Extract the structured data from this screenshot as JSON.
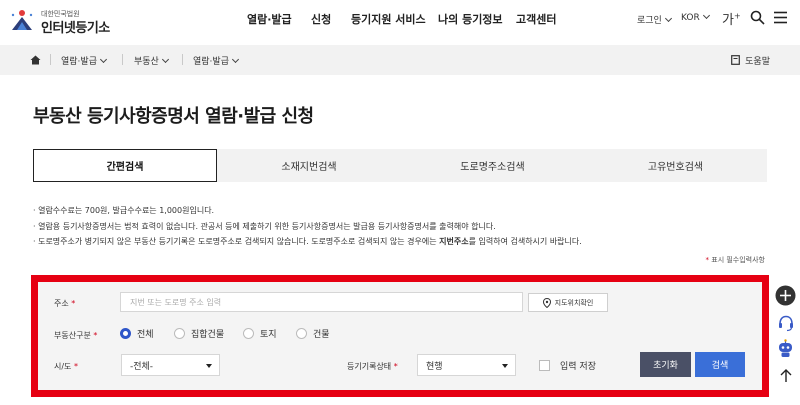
{
  "header": {
    "logo_small": "대한민국법원",
    "logo_big": "인터넷등기소",
    "nav": [
      "열람·발급",
      "신청",
      "등기지원 서비스",
      "나의 등기정보",
      "고객센터"
    ],
    "login": "로그인",
    "language": "KOR",
    "font_size": "가",
    "font_size_plus": "+"
  },
  "breadcrumb": {
    "items": [
      "열람·발급",
      "부동산",
      "열람·발급"
    ],
    "help": "도움말"
  },
  "page_title": "부동산 등기사항증명서 열람·발급 신청",
  "tabs": [
    {
      "label": "간편검색",
      "active": true
    },
    {
      "label": "소재지번검색",
      "active": false
    },
    {
      "label": "도로명주소검색",
      "active": false
    },
    {
      "label": "고유번호검색",
      "active": false
    }
  ],
  "notes": {
    "line1": "· 열람수수료는  700원, 발급수수료는  1,000원입니다.",
    "line2": "· 열람용 등기사항증명서는 법적 효력이 없습니다. 관공서 등에 제출하기 위한 등기사항증명서는 발급용 등기사항증명서를 출력해야 합니다.",
    "line3_a": "· 도로명주소가 병기되지 않은 부동산 등기기록은 도로명주소로 검색되지 않습니다. 도로명주소로 검색되지 않는 경우에는 ",
    "line3_bold": "지번주소",
    "line3_b": "를 입력하여 검색하시기 바랍니다."
  },
  "required_note_star": "*",
  "required_note": "표시 필수입력사항",
  "form": {
    "address_label": "주소",
    "address_placeholder": "지번 또는 도로명 주소 입력",
    "map_button": "지도위치확인",
    "type_label": "부동산구분",
    "type_options": [
      "전체",
      "집합건물",
      "토지",
      "건물"
    ],
    "type_selected": "전체",
    "region_label": "시/도",
    "region_value": "-전체-",
    "status_label": "등기기록상태",
    "status_value": "현행",
    "save_label": "입력 저장",
    "reset_button": "초기화",
    "search_button": "검색",
    "required_star": "*"
  },
  "colors": {
    "highlight_frame": "#e60012",
    "radio_selected": "#2f56c9",
    "reset_button": "#4a5066",
    "search_button": "#3a6fd8"
  }
}
